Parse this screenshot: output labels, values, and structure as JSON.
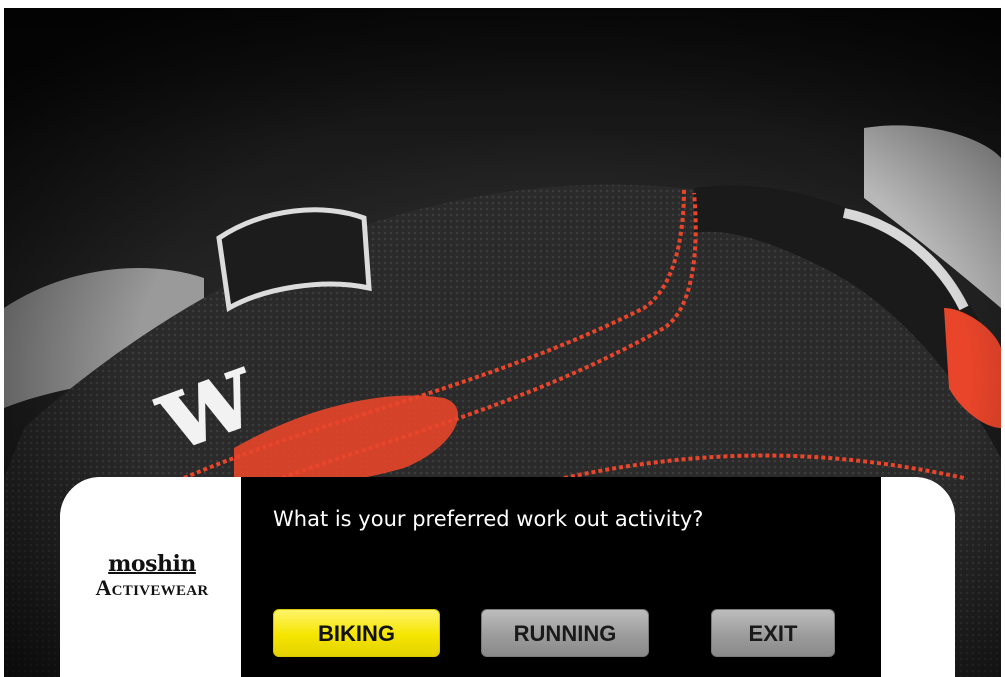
{
  "video": {
    "scene": "glove-closeup",
    "accent_color": "#e8452a"
  },
  "brand": {
    "logo_line1": "moshin",
    "logo_line2": "Activewear"
  },
  "prompt": {
    "question": "What is your preferred work out activity?"
  },
  "buttons": {
    "biking_label": "BIKING",
    "running_label": "RUNNING",
    "exit_label": "EXIT",
    "selected_color": "#f5e500",
    "default_color": "#9c9c9c"
  }
}
